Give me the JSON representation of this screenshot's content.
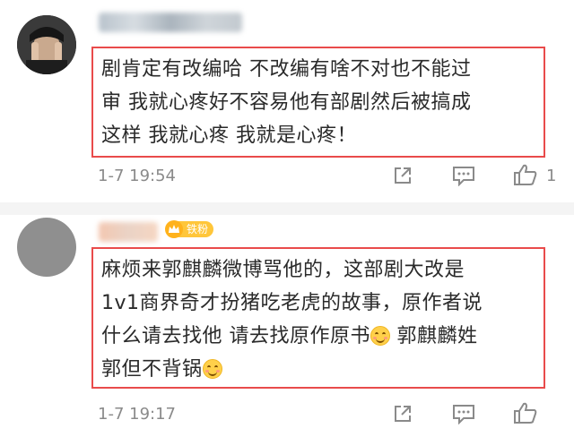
{
  "comments": [
    {
      "text": "剧肯定有改编哈 不改编有啥不对也不能过\n审 我就心疼好不容易他有部剧然后被搞成\n这样 我就心疼 我就是心疼！",
      "time": "1-7 19:54",
      "like_count": "1"
    },
    {
      "badge": "铁粉",
      "text_line1": "麻烦来郭麒麟微博骂他的，这部剧大改是",
      "text_line2": "1v1商界奇才扮猪吃老虎的故事，原作者说",
      "text_line3a": "什么请去找他 请去找原作原书",
      "text_line3b": " 郭麒麟姓",
      "text_line4": "郭但不背锅",
      "time": "1-7 19:17"
    }
  ],
  "colors": {
    "highlight_border": "#e94b4b",
    "badge_bg": "#ffc63a",
    "meta_text": "#8a8a8a"
  },
  "icons": [
    "share-icon",
    "comment-icon",
    "like-icon",
    "smile-emoji-icon",
    "crown-icon"
  ]
}
